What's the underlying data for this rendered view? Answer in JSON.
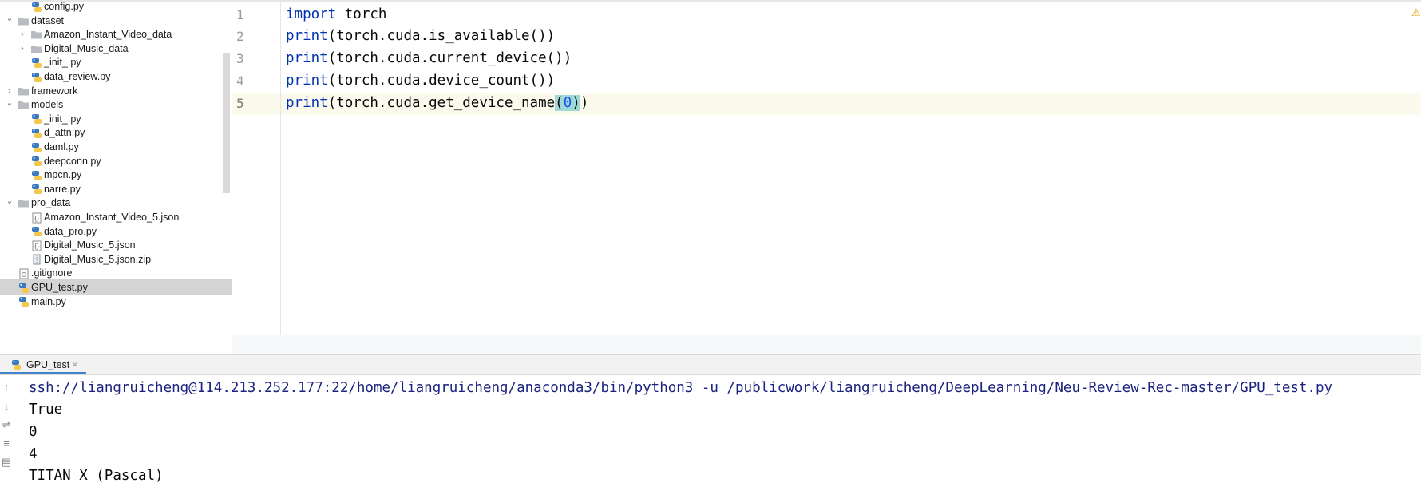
{
  "tree": {
    "items": [
      {
        "label": "config.py",
        "type": "python",
        "depth": 2,
        "expander": "none",
        "selected": false
      },
      {
        "label": "dataset",
        "type": "folder",
        "depth": 1,
        "expander": "open",
        "selected": false
      },
      {
        "label": "Amazon_Instant_Video_data",
        "type": "folder",
        "depth": 2,
        "expander": "closed",
        "selected": false
      },
      {
        "label": "Digital_Music_data",
        "type": "folder",
        "depth": 2,
        "expander": "closed",
        "selected": false
      },
      {
        "label": "_init_.py",
        "type": "python",
        "depth": 2,
        "expander": "none",
        "selected": false
      },
      {
        "label": "data_review.py",
        "type": "python",
        "depth": 2,
        "expander": "none",
        "selected": false
      },
      {
        "label": "framework",
        "type": "folder",
        "depth": 1,
        "expander": "closed",
        "selected": false
      },
      {
        "label": "models",
        "type": "folder",
        "depth": 1,
        "expander": "open",
        "selected": false
      },
      {
        "label": "_init_.py",
        "type": "python",
        "depth": 2,
        "expander": "none",
        "selected": false
      },
      {
        "label": "d_attn.py",
        "type": "python",
        "depth": 2,
        "expander": "none",
        "selected": false
      },
      {
        "label": "daml.py",
        "type": "python",
        "depth": 2,
        "expander": "none",
        "selected": false
      },
      {
        "label": "deepconn.py",
        "type": "python",
        "depth": 2,
        "expander": "none",
        "selected": false
      },
      {
        "label": "mpcn.py",
        "type": "python",
        "depth": 2,
        "expander": "none",
        "selected": false
      },
      {
        "label": "narre.py",
        "type": "python",
        "depth": 2,
        "expander": "none",
        "selected": false
      },
      {
        "label": "pro_data",
        "type": "folder",
        "depth": 1,
        "expander": "open",
        "selected": false
      },
      {
        "label": "Amazon_Instant_Video_5.json",
        "type": "json",
        "depth": 2,
        "expander": "none",
        "selected": false
      },
      {
        "label": "data_pro.py",
        "type": "python",
        "depth": 2,
        "expander": "none",
        "selected": false
      },
      {
        "label": "Digital_Music_5.json",
        "type": "json",
        "depth": 2,
        "expander": "none",
        "selected": false
      },
      {
        "label": "Digital_Music_5.json.zip",
        "type": "zip",
        "depth": 2,
        "expander": "none",
        "selected": false
      },
      {
        "label": ".gitignore",
        "type": "ignore",
        "depth": 1,
        "expander": "none",
        "selected": false
      },
      {
        "label": "GPU_test.py",
        "type": "python",
        "depth": 1,
        "expander": "none",
        "selected": true
      },
      {
        "label": "main.py",
        "type": "python",
        "depth": 1,
        "expander": "none",
        "selected": false
      }
    ]
  },
  "editor": {
    "line_numbers": [
      "1",
      "2",
      "3",
      "4",
      "5"
    ],
    "current_line": 5,
    "lines": [
      [
        {
          "t": "import",
          "c": "kw"
        },
        {
          "t": " torch",
          "c": "plain"
        }
      ],
      [
        {
          "t": "print",
          "c": "kw"
        },
        {
          "t": "(torch.cuda.is_available())",
          "c": "plain"
        }
      ],
      [
        {
          "t": "print",
          "c": "kw"
        },
        {
          "t": "(torch.cuda.current_device())",
          "c": "plain"
        }
      ],
      [
        {
          "t": "print",
          "c": "kw"
        },
        {
          "t": "(torch.cuda.device_count())",
          "c": "plain"
        }
      ],
      [
        {
          "t": "print",
          "c": "kw"
        },
        {
          "t": "(torch.cuda.get_device_name",
          "c": "plain"
        },
        {
          "t": "(",
          "c": "brace"
        },
        {
          "t": "0",
          "c": "num"
        },
        {
          "t": ")",
          "c": "brace"
        },
        {
          "t": ")",
          "c": "plain"
        }
      ]
    ],
    "warning_icon": "warning-triangle-icon"
  },
  "run_panel": {
    "tab_label": "GPU_test",
    "tab_icon": "python-file-icon",
    "close_icon": "close-icon",
    "tools": [
      "arrow-up-icon",
      "arrow-down-icon",
      "soft-wrap-icon",
      "scroll-to-end-icon",
      "print-icon"
    ],
    "output": [
      "ssh://liangruicheng@114.213.252.177:22/home/liangruicheng/anaconda3/bin/python3 -u /publicwork/liangruicheng/DeepLearning/Neu-Review-Rec-master/GPU_test.py",
      "True",
      "0",
      "4",
      "TITAN X (Pascal)"
    ]
  },
  "colors": {
    "keyword": "#0033b3",
    "selection_row": "#d4d4d4",
    "current_line": "#fcfaed",
    "brace_match": "#9ed8d8",
    "tab_underline": "#4083c9",
    "command_text": "#1a237e"
  }
}
